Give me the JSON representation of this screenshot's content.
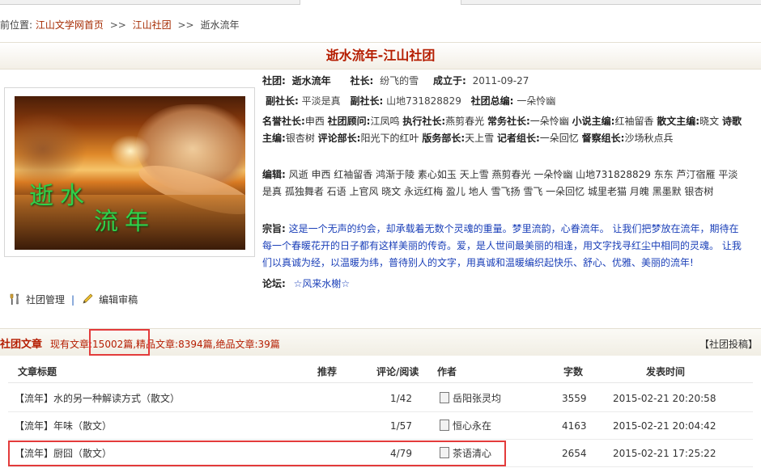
{
  "breadcrumb": {
    "prefix": "前位置:",
    "home": "江山文学网首页",
    "sep1": ">>",
    "club": "江山社团",
    "sep2": ">>",
    "current": "逝水流年"
  },
  "page_title": "逝水流年-江山社团",
  "cover": {
    "text1": "逝水",
    "text2": "流年"
  },
  "manage": {
    "manage_label": "社团管理",
    "divider": "|",
    "edit_label": "编辑审稿"
  },
  "info": {
    "row1": {
      "club_label": "社团:",
      "club_value": "逝水流年",
      "president_label": "社长:",
      "president_value": "纷飞的雪",
      "founded_label": "成立于:",
      "founded_value": "2011-09-27"
    },
    "row2": {
      "vp_label1": "副社长:",
      "vp_value1": "平淡是真",
      "vp_label2": "副社长:",
      "vp_value2": "山地731828829",
      "chief_label": "社团总编:",
      "chief_value": "一朵怜幽"
    },
    "roles_para": {
      "l1": "名誉社长:",
      "v1": "申西",
      "l2": "社团顾问:",
      "v2": "江凤鸣",
      "l3": "执行社长:",
      "v3": "燕剪春光",
      "l4": "常务社长:",
      "v4": "一朵怜幽",
      "l5": "小说主编:",
      "v5": "红袖留香",
      "l6": "散文主编:",
      "v6": "晓文",
      "l7": "诗歌主编:",
      "v7": "银杏树",
      "l8": "评论部长:",
      "v8": "阳光下的红叶",
      "l9": "版务部长:",
      "v9": "天上雪",
      "l10": "记者组长:",
      "v10": "一朵回忆",
      "l11": "督察组长:",
      "v11": "沙场秋点兵"
    },
    "editors_label": "编辑:",
    "editors_value": "风逝 申西 红袖留香 鸿渐于陵 素心如玉 天上雪 燕剪春光 一朵怜幽 山地731828829 东东 芦汀宿雁 平淡是真 孤独舞者 石语 上官风 晓文 永远红梅 盈儿 地人 雪飞扬 雪飞 一朵回忆 城里老猫 月魄 黑墨默 银杏树",
    "motto_label": "宗旨:",
    "motto_value": "这是一个无声的约会，却承载着无数个灵魂的重量。梦里流韵，心眷流年。 让我们把梦放在流年，期待在每一个春暖花开的日子都有这样美丽的传奇。爱，是人世间最美丽的相逢，用文字找寻红尘中相同的灵魂。 让我们以真诚为经，以温暖为纬，普待别人的文字，用真诚和温暖编织起快乐、舒心、优雅、美丽的流年!",
    "forum_label": "论坛:",
    "forum_value": "☆风来水榭☆"
  },
  "articles_section": {
    "title": "社团文章",
    "existing_prefix": "现有文章:",
    "existing_count": "15002篇",
    "fine_text": ",精品文章:8394篇,绝品文章:39篇",
    "submit_label": "【社团投稿】"
  },
  "table": {
    "headers": {
      "title": "文章标题",
      "recommend": "推荐",
      "comments": "评论/阅读",
      "author": "作者",
      "words": "字数",
      "time": "发表时间"
    },
    "rows": [
      {
        "title": "【流年】水的另一种解读方式（散文）",
        "comments": "1/42",
        "author": "岳阳张灵均",
        "words": "3559",
        "time": "2015-02-21 20:20:58"
      },
      {
        "title": "【流年】年味（散文）",
        "comments": "1/57",
        "author": "恒心永在",
        "words": "4163",
        "time": "2015-02-21 20:04:42"
      },
      {
        "title": "【流年】厨囧（散文）",
        "comments": "4/79",
        "author": "茶语清心",
        "words": "2654",
        "time": "2015-02-21 17:25:22"
      }
    ]
  },
  "colors": {
    "accent_red": "#b51d00",
    "link_blue": "#1a3fb8",
    "highlight_box": "#e33b3b"
  }
}
